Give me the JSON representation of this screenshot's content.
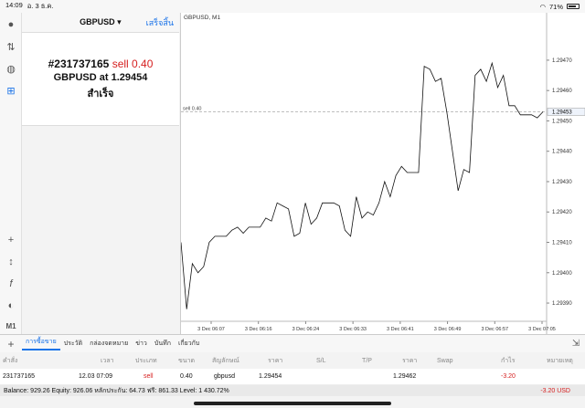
{
  "status": {
    "time": "14:09",
    "date": "อ. 3 ธ.ค.",
    "battery": "71%"
  },
  "panel": {
    "symbol": "GBPUSD",
    "done_label": "เสร็จสิ้น"
  },
  "order": {
    "ticket": "#231737165",
    "type": "sell 0.40",
    "line2_prefix": "GBPUSD at",
    "price": "1.29454",
    "result": "สำเร็จ"
  },
  "chart_data": {
    "type": "line",
    "title": "GBPUSD, M1",
    "position_label": "sell 0.40",
    "current_price": "1.29453",
    "y_ticks": [
      "1.29470",
      "1.29460",
      "1.29450",
      "1.29440",
      "1.29430",
      "1.29420",
      "1.29410",
      "1.29400",
      "1.29390"
    ],
    "x_ticks": [
      "3 Dec 06:07",
      "3 Dec 06:16",
      "3 Dec 06:24",
      "3 Dec 06:33",
      "3 Dec 06:41",
      "3 Dec 06:49",
      "3 Dec 06:57",
      "3 Dec 07:05"
    ],
    "ylim": [
      1.29384,
      1.29482
    ],
    "values": [
      1.2941,
      1.29388,
      1.29403,
      1.294,
      1.29402,
      1.2941,
      1.29412,
      1.29412,
      1.29412,
      1.29414,
      1.29415,
      1.29413,
      1.29415,
      1.29415,
      1.29415,
      1.29418,
      1.29417,
      1.29423,
      1.29422,
      1.29421,
      1.29412,
      1.29413,
      1.29423,
      1.29416,
      1.29418,
      1.29423,
      1.29423,
      1.29423,
      1.29422,
      1.29414,
      1.29412,
      1.29425,
      1.29418,
      1.2942,
      1.29419,
      1.29423,
      1.2943,
      1.29425,
      1.29432,
      1.29435,
      1.29433,
      1.29433,
      1.29433,
      1.29468,
      1.29467,
      1.29463,
      1.29464,
      1.29453,
      1.2944,
      1.29427,
      1.29434,
      1.29433,
      1.29465,
      1.29467,
      1.29463,
      1.29469,
      1.29461,
      1.29465,
      1.29455,
      1.29455,
      1.29452,
      1.29452,
      1.29452,
      1.29451,
      1.29453
    ]
  },
  "tabs": [
    "การซื้อขาย",
    "ประวัติ",
    "กล่องจดหมาย",
    "ข่าว",
    "บันทึก",
    "เกี่ยวกับ"
  ],
  "table": {
    "headers": [
      "คำสั่ง",
      "เวลา",
      "ประเภท",
      "ขนาด",
      "สัญลักษณ์",
      "ราคา",
      "S/L",
      "T/P",
      "ราคา",
      "Swap",
      "กำไร",
      "หมายเหตุ"
    ],
    "row": [
      "231737165",
      "12.03 07:09",
      "sell",
      "0.40",
      "gbpusd",
      "1.29454",
      "",
      "",
      "1.29462",
      "",
      "-3.20",
      ""
    ]
  },
  "footer": {
    "balance": "Balance: 929.26 Equity: 926.06 หลักประกัน: 64.73 ฟรี: 861.33 Level: 1 430.72%",
    "profit": "-3.20  USD"
  }
}
